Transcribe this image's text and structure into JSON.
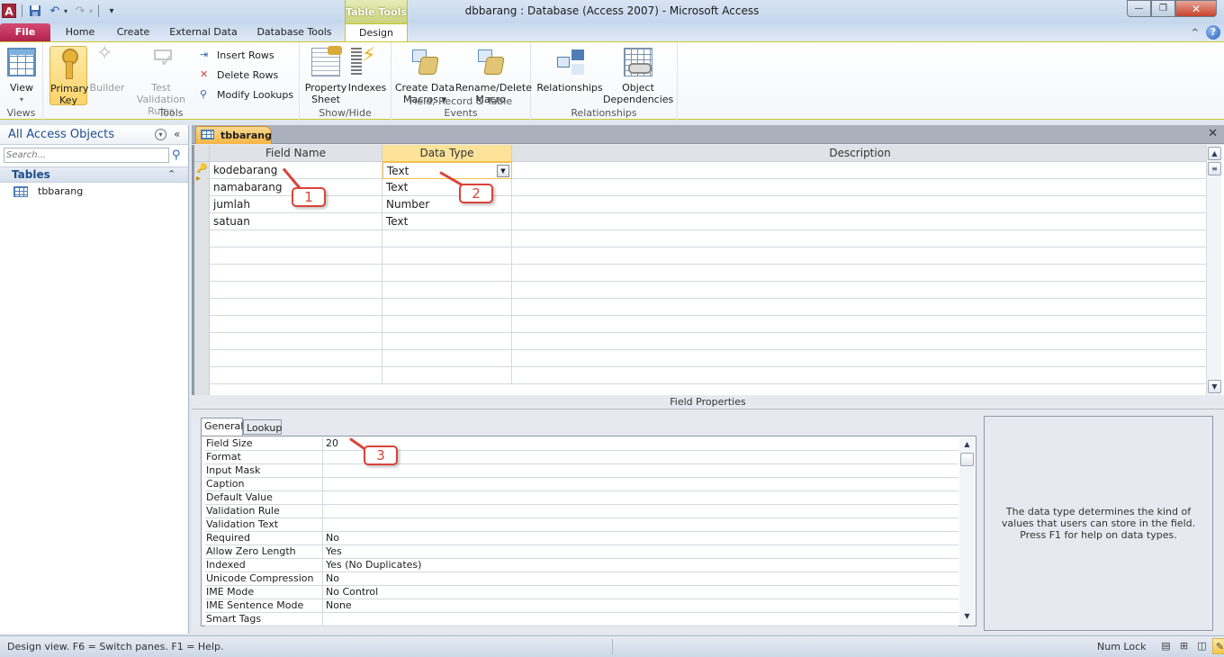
{
  "window": {
    "title": "dbbarang : Database (Access 2007)  -  Microsoft Access",
    "app_icon": "A",
    "controls": {
      "minimize": "—",
      "restore": "❐",
      "close": "✕"
    }
  },
  "quick_access": {
    "save_icon": "💾",
    "undo_icon": "↶",
    "redo_icon": "↷",
    "customize_icon": "▾"
  },
  "ribbon": {
    "contextual_header": "Table Tools",
    "tabs": [
      {
        "label": "File"
      },
      {
        "label": "Home"
      },
      {
        "label": "Create"
      },
      {
        "label": "External Data"
      },
      {
        "label": "Database Tools"
      },
      {
        "label": "Design",
        "active": true
      }
    ],
    "minimize_icon": "^",
    "help_icon": "?",
    "groups": {
      "views": {
        "label": "Views",
        "view": "View",
        "view_arrow": "▾"
      },
      "tools": {
        "label": "Tools",
        "primary_key": [
          "Primary",
          "Key"
        ],
        "builder": "Builder",
        "test_validation": [
          "Test Validation",
          "Rules"
        ],
        "insert_rows": "Insert Rows",
        "delete_rows": "Delete Rows",
        "modify_lookups": "Modify Lookups"
      },
      "show_hide": {
        "label": "Show/Hide",
        "property_sheet": [
          "Property",
          "Sheet"
        ],
        "indexes": "Indexes"
      },
      "events": {
        "label": "Field, Record & Table Events",
        "create_data_macros": [
          "Create Data",
          "Macros ▾"
        ],
        "rename_delete_macro": [
          "Rename/Delete",
          "Macro"
        ]
      },
      "relationships": {
        "label": "Relationships",
        "relationships": "Relationships",
        "object_dependencies": [
          "Object",
          "Dependencies"
        ]
      }
    }
  },
  "nav_pane": {
    "title": "All Access Objects",
    "menu_icon": "▾",
    "collapse_icon": "«",
    "search_placeholder": "Search...",
    "search_icon": "⚲",
    "group": {
      "title": "Tables",
      "collapse_icon": "⌃"
    },
    "items": [
      {
        "label": "tbbarang"
      }
    ]
  },
  "document": {
    "tab_label": "tbbarang",
    "close_icon": "✕",
    "columns": {
      "field_name": "Field Name",
      "data_type": "Data Type",
      "description": "Description"
    },
    "rows": [
      {
        "field_name": "kodebarang",
        "data_type": "Text",
        "description": "",
        "primary_key": true,
        "selected": true
      },
      {
        "field_name": "namabarang",
        "data_type": "Text",
        "description": ""
      },
      {
        "field_name": "jumlah",
        "data_type": "Number",
        "description": ""
      },
      {
        "field_name": "satuan",
        "data_type": "Text",
        "description": ""
      }
    ],
    "field_properties_label": "Field Properties",
    "property_tabs": [
      {
        "label": "General",
        "active": true
      },
      {
        "label": "Lookup"
      }
    ],
    "properties": [
      {
        "name": "Field Size",
        "value": "20"
      },
      {
        "name": "Format",
        "value": ""
      },
      {
        "name": "Input Mask",
        "value": ""
      },
      {
        "name": "Caption",
        "value": ""
      },
      {
        "name": "Default Value",
        "value": ""
      },
      {
        "name": "Validation Rule",
        "value": ""
      },
      {
        "name": "Validation Text",
        "value": ""
      },
      {
        "name": "Required",
        "value": "No"
      },
      {
        "name": "Allow Zero Length",
        "value": "Yes"
      },
      {
        "name": "Indexed",
        "value": "Yes (No Duplicates)"
      },
      {
        "name": "Unicode Compression",
        "value": "No"
      },
      {
        "name": "IME Mode",
        "value": "No Control"
      },
      {
        "name": "IME Sentence Mode",
        "value": "None"
      },
      {
        "name": "Smart Tags",
        "value": ""
      }
    ],
    "help_text": "The data type determines the kind of values that users can store in the field. Press F1 for help on data types."
  },
  "callouts": [
    {
      "label": "1"
    },
    {
      "label": "2"
    },
    {
      "label": "3"
    }
  ],
  "statusbar": {
    "text": "Design view.  F6 = Switch panes.  F1 = Help.",
    "num_lock": "Num Lock",
    "views": [
      "datasheet-view",
      "pivot-table-view",
      "pivot-chart-view",
      "design-view"
    ]
  }
}
